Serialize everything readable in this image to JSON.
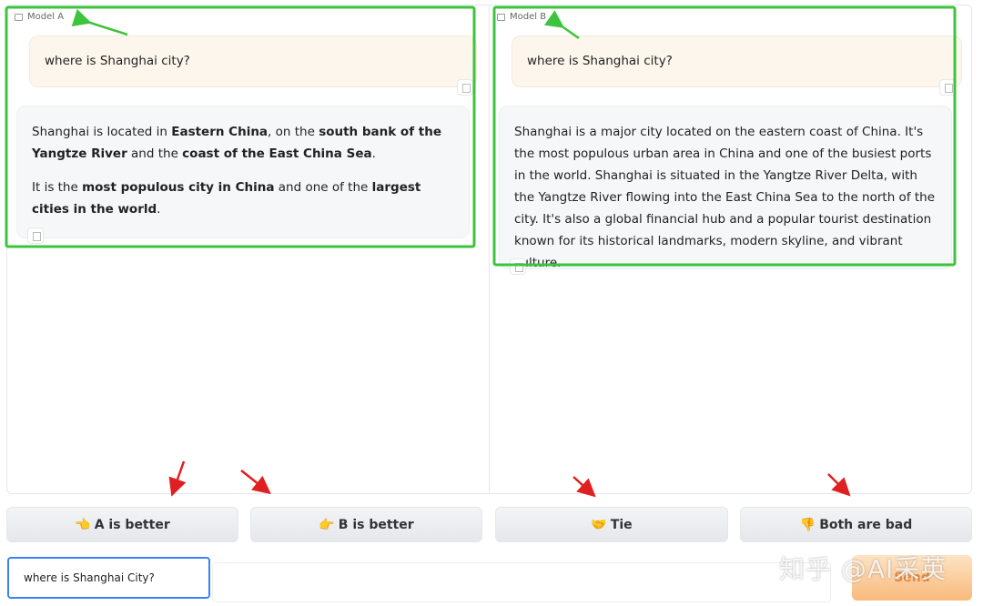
{
  "model_a": {
    "label": "Model A",
    "user_message": "where is Shanghai city?",
    "response": [
      [
        {
          "t": "Shanghai is located in "
        },
        {
          "t": "Eastern China",
          "b": true
        },
        {
          "t": ", on the "
        },
        {
          "t": "south bank of the Yangtze River",
          "b": true
        },
        {
          "t": " and the "
        },
        {
          "t": "coast of the East China Sea",
          "b": true
        },
        {
          "t": "."
        }
      ],
      [
        {
          "t": "It is the "
        },
        {
          "t": "most populous city in China",
          "b": true
        },
        {
          "t": " and one of the "
        },
        {
          "t": "largest cities in the world",
          "b": true
        },
        {
          "t": "."
        }
      ]
    ]
  },
  "model_b": {
    "label": "Model B",
    "user_message": "where is Shanghai city?",
    "response": "Shanghai is a major city located on the eastern coast of China. It's the most populous urban area in China and one of the busiest ports in the world. Shanghai is situated in the Yangtze River Delta, with the Yangtze River flowing into the East China Sea to the north of the city. It's also a global financial hub and a popular tourist destination known for its historical landmarks, modern skyline, and vibrant culture."
  },
  "vote_buttons": [
    {
      "emoji": "👈",
      "label": "A is better"
    },
    {
      "emoji": "👉",
      "label": "B is better"
    },
    {
      "emoji": "🤝",
      "label": "Tie"
    },
    {
      "emoji": "👎",
      "label": "Both are bad"
    }
  ],
  "input": {
    "value": "where is Shanghai City?"
  },
  "send_label": "Send",
  "watermark": "知乎 @AI采英",
  "colors": {
    "annotation_box": "#3cc43c",
    "annotation_arrow_red": "#e02020",
    "input_focus": "#3b82f6",
    "send": "#f9b97a"
  }
}
